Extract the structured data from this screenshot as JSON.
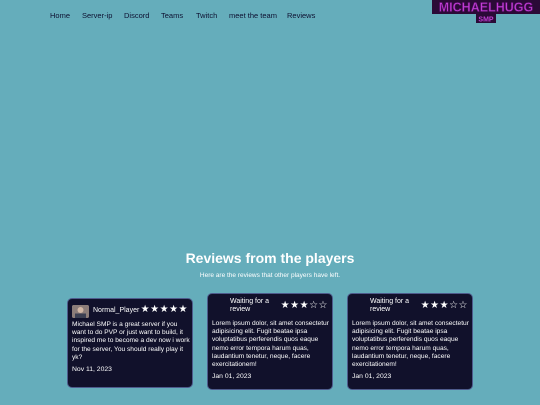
{
  "nav": {
    "items": [
      "Home",
      "Server-ip",
      "Discord",
      "Teams",
      "Twitch",
      "meet the team",
      "Reviews"
    ],
    "logo_text": "MICHAELHUGG",
    "logo_sub": "SMP"
  },
  "reviews": {
    "title": "Reviews from the players",
    "subtitle": "Here are the reviews that other players have left.",
    "cards": [
      {
        "author": "Normal_Player",
        "rating": 5,
        "stars": "★★★★★",
        "text": "Michael SMP is a great server if you want to do PVP or just want to build, it inspired me to become a dev now i work for the server, You should really play it yk?",
        "date": "Nov 11, 2023"
      },
      {
        "author": "Waiting for a review",
        "rating": 3,
        "stars": "★★★☆☆",
        "text": "Lorem ipsum dolor, sit amet consectetur adipisicing elit. Fugit beatae ipsa voluptatibus perferendis quos eaque nemo error tempora harum quas, laudantium tenetur, neque, facere exercitationem!",
        "date": "Jan 01, 2023"
      },
      {
        "author": "Waiting for a review",
        "rating": 3,
        "stars": "★★★☆☆",
        "text": "Lorem ipsum dolor, sit amet consectetur adipisicing elit. Fugit beatae ipsa voluptatibus perferendis quos eaque nemo error tempora harum quas, laudantium tenetur, neque, facere exercitationem!",
        "date": "Jan 01, 2023"
      }
    ]
  },
  "colors": {
    "background": "#65adbb",
    "card": "#11112b",
    "card_border": "#4e5b8c",
    "logo": "#c23fd6"
  }
}
